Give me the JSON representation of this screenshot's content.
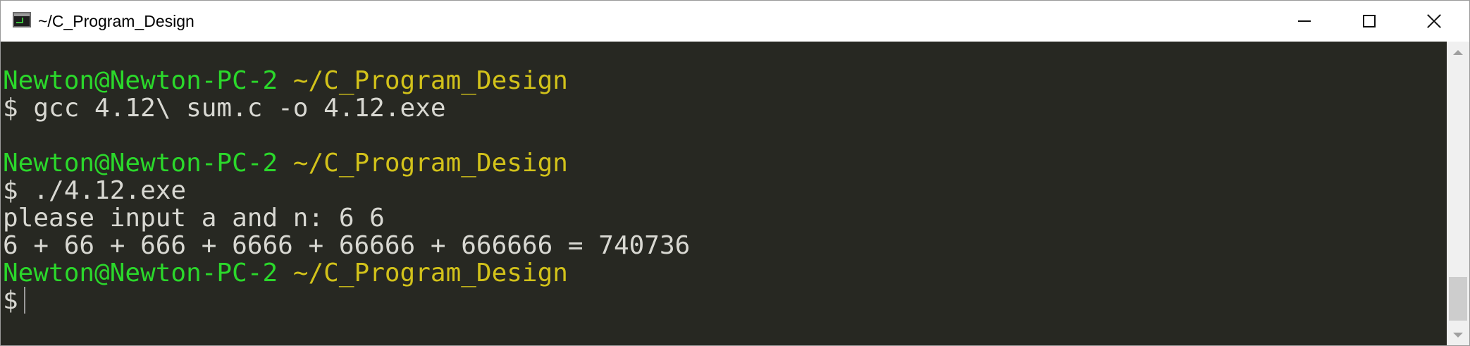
{
  "window": {
    "title": "~/C_Program_Design",
    "app_icon": "terminal-icon"
  },
  "controls": {
    "minimize_icon": "minimize-icon",
    "maximize_icon": "maximize-icon",
    "close_icon": "close-icon"
  },
  "terminal": {
    "lines": [
      {
        "user": "Newton@Newton-PC-2",
        "path": "~/C_Program_Design"
      },
      {
        "text": "$ gcc 4.12\\ sum.c -o 4.12.exe"
      },
      {
        "text": ""
      },
      {
        "user": "Newton@Newton-PC-2",
        "path": "~/C_Program_Design"
      },
      {
        "text": "$ ./4.12.exe"
      },
      {
        "text": "please input a and n: 6 6"
      },
      {
        "text": "6 + 66 + 666 + 6666 + 66666 + 666666 = 740736"
      },
      {
        "user": "Newton@Newton-PC-2",
        "path": "~/C_Program_Design"
      },
      {
        "text": "$"
      }
    ]
  },
  "colors": {
    "background": "#272822",
    "text": "#d8d8d2",
    "user": "#2bd82b",
    "path": "#d2c21a"
  }
}
